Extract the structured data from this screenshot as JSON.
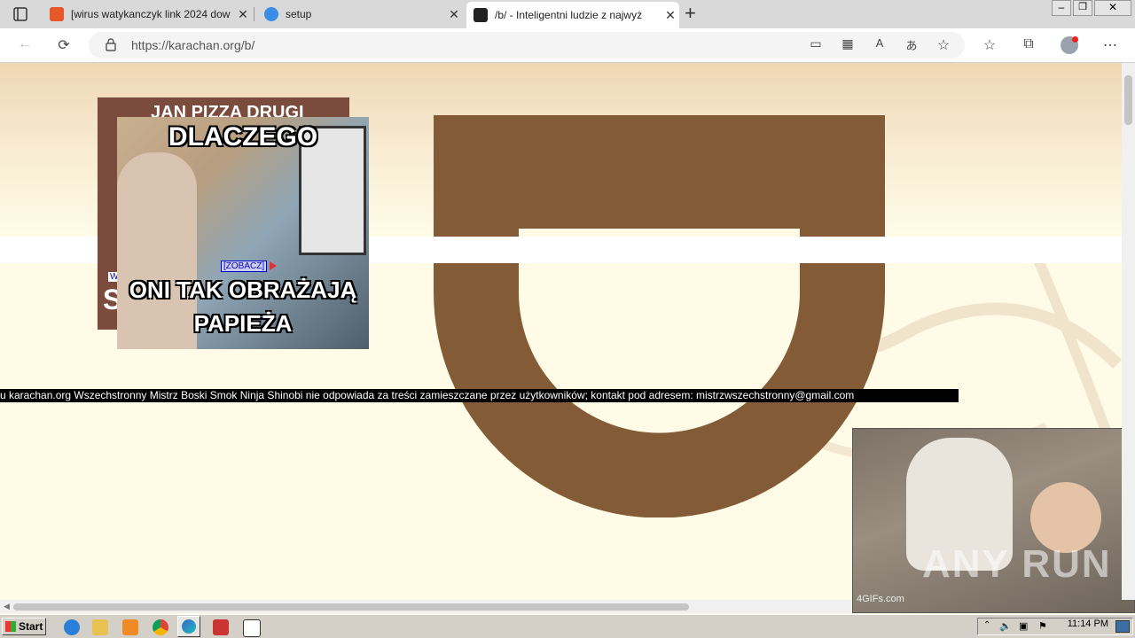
{
  "browser": {
    "tabs": [
      {
        "title": "[wirus watykanczyk link 2024 dow"
      },
      {
        "title": "setup"
      },
      {
        "title": "/b/ - Inteligentni ludzie z najwyż"
      }
    ],
    "new_tab_label": "+",
    "url": "https://karachan.org/b/",
    "window_controls": {
      "minimize": "–",
      "restore": "❐",
      "close": "✕"
    }
  },
  "page": {
    "meme": {
      "back_top_text": "JAN PIZZA DRUGI",
      "back_left_letter": "S",
      "back_small_label": "W",
      "top_text": "DLACZEGO",
      "bottom_text_1": "ONI TAK OBRAŻAJĄ",
      "bottom_text_2": "PAPIEŻA",
      "link_text": "[ZOBACZ]"
    },
    "footer_text": "u karachan.org Wszechstronny Mistrz Boski Smok Ninja Shinobi nie odpowiada za treści zamieszczane przez użytkowników; kontakt pod adresem: mistrzwszechstronny@gmail.com",
    "gif": {
      "watermark": "ANY RUN",
      "credit": "4GIFs.com"
    }
  },
  "taskbar": {
    "start_label": "Start",
    "clock": "11:14 PM"
  },
  "colors": {
    "logo_brown": "#835c37",
    "page_bg": "#fffbe6",
    "footer_bg": "#000000"
  }
}
